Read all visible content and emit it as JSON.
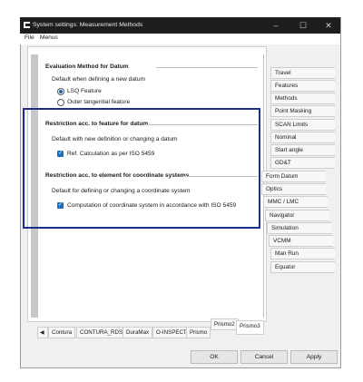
{
  "window": {
    "title": "System settings: Measurement Methods"
  },
  "menu": {
    "file": "File",
    "menus": "Menus"
  },
  "evaluation": {
    "title": "Evaluation Method for Datum",
    "subtitle": "Default when defining a new datum",
    "options": [
      "LSQ Feature",
      "Outer tangential feature"
    ],
    "selected": "LSQ Feature"
  },
  "restriction_feature": {
    "title": "Restriction acc. to feature for datum",
    "subtitle": "Default with new definition or changing a datum",
    "checkbox_label": "Ref. Calculation as per ISO 5459",
    "checked": true
  },
  "restriction_element": {
    "title": "Restriction acc. to element for coordinate systems",
    "subtitle": "Default for defining or changing a coordinate system",
    "checkbox_label": "Computation of coordinate system in accordance with ISO 5459",
    "checked": true
  },
  "right_tabs": [
    "Travel",
    "Features",
    "Methods",
    "Point Masking",
    "SCAN Limits",
    "Nominal",
    "Start angle",
    "GD&T",
    "Form Datum",
    "Optics",
    "MMC / LMC",
    "Navigator",
    "Simulation",
    "VCMM",
    "Man Run",
    "Equator"
  ],
  "bottom_tabs": [
    "Contura",
    "CONTURA_RDS",
    "DuraMax",
    "O-INSPECT",
    "Prismo",
    "Prismo2",
    "Prismo3"
  ],
  "buttons": {
    "ok": "OK",
    "cancel": "Cancel",
    "apply": "Apply"
  }
}
